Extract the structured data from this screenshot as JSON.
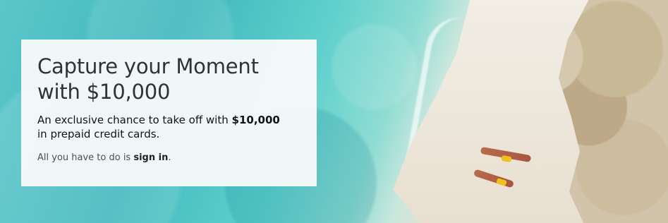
{
  "promo": {
    "headline_line1": "Capture your Moment",
    "headline_line2": "with $10,000",
    "description_prefix": "An exclusive chance to take off with ",
    "description_amount": "$10,000",
    "description_line2": "in prepaid credit cards.",
    "signin_prefix": "All you have to do is ",
    "signin_link": "sign in",
    "signin_suffix": "."
  },
  "style": {
    "accent_text": "#1f2329",
    "panel_bg": "#f6f9f9"
  }
}
